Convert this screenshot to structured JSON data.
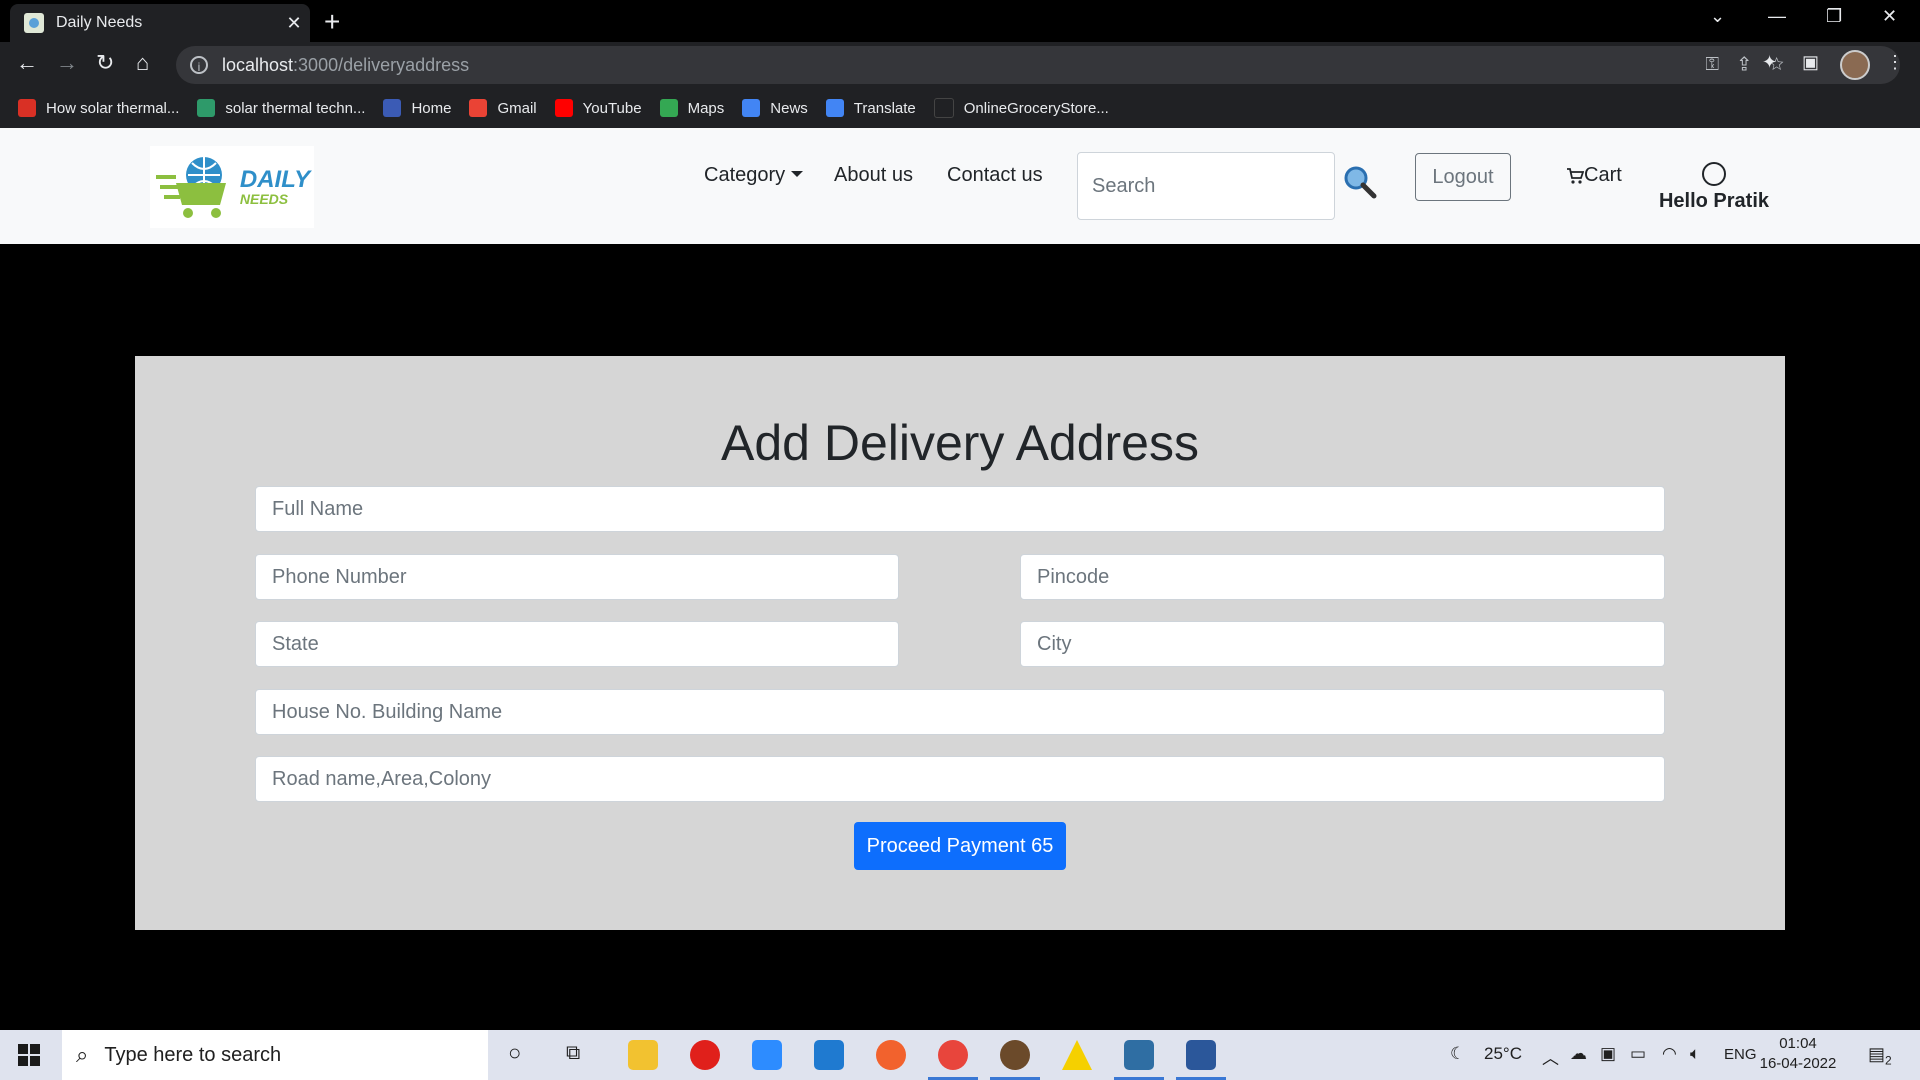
{
  "browser": {
    "tab_title": "Daily Needs",
    "tab_close": "✕",
    "new_tab": "+",
    "url_host": "localhost",
    "url_path": ":3000/deliveryaddress",
    "bookmarks": [
      {
        "label": "How solar thermal...",
        "color": "#d93025"
      },
      {
        "label": "solar thermal techn...",
        "color": "#2e9a6a"
      },
      {
        "label": "Home",
        "color": "#3b5bb5"
      },
      {
        "label": "Gmail",
        "color": "#ea4335"
      },
      {
        "label": "YouTube",
        "color": "#ff0000"
      },
      {
        "label": "Maps",
        "color": "#34a853"
      },
      {
        "label": "News",
        "color": "#4285f4"
      },
      {
        "label": "Translate",
        "color": "#4285f4"
      },
      {
        "label": "OnlineGroceryStore...",
        "color": "#202124"
      }
    ]
  },
  "site": {
    "logo_line1": "DAILY",
    "logo_line2": "NEEDS",
    "nav": {
      "category": "Category",
      "about": "About us",
      "contact": "Contact us"
    },
    "search_placeholder": "Search",
    "logout": "Logout",
    "cart": "Cart",
    "greeting": "Hello Pratik"
  },
  "form": {
    "title": "Add Delivery Address",
    "full_name": "Full Name",
    "phone": "Phone Number",
    "pincode": "Pincode",
    "state": "State",
    "city": "City",
    "house": "House No. Building Name",
    "road": "Road name,Area,Colony",
    "submit": "Proceed Payment 65"
  },
  "taskbar": {
    "search_placeholder": "Type here to search",
    "weather": "25°C",
    "lang": "ENG",
    "time": "01:04",
    "date": "16-04-2022",
    "notifications": "2"
  }
}
